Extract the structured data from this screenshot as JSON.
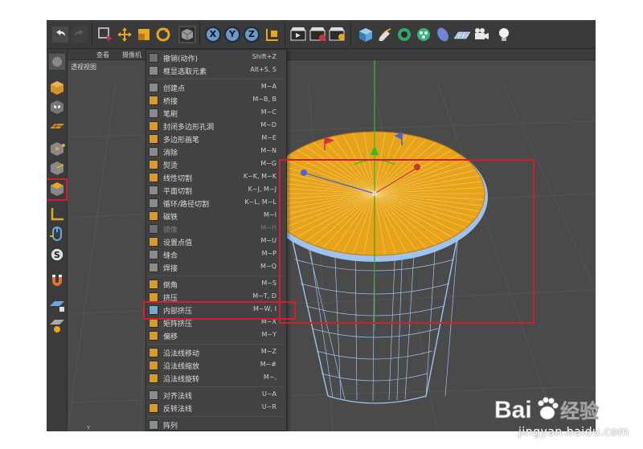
{
  "toolbar": {
    "icons": [
      "undo-icon",
      "redo-icon",
      "live-select-icon",
      "move-icon",
      "scale-icon",
      "rotate-icon",
      "object-mode-icon",
      "x-axis-lock",
      "y-axis-lock",
      "z-axis-lock",
      "world-coordinates-icon",
      "render-view-icon",
      "render-picture-viewer-icon",
      "render-settings-icon",
      "cube-icon",
      "pen-icon",
      "subdivision-icon",
      "cloner-icon",
      "deformer-icon",
      "floor-icon",
      "camera-icon",
      "light-icon"
    ],
    "x_label": "X",
    "y_label": "Y",
    "z_label": "Z"
  },
  "viewport": {
    "menu": [
      "查看",
      "摄像机",
      "显示"
    ],
    "label": "透视视图",
    "axis_y": "Y"
  },
  "context_menu": {
    "items": [
      {
        "label": "撤销(动作)",
        "shortcut": "Shift+Z",
        "icon": "undo-icon",
        "enabled": true
      },
      {
        "label": "框显选取元素",
        "shortcut": "Alt+S, S",
        "icon": "frame-selected-icon",
        "enabled": true
      },
      {
        "label": "创建点",
        "shortcut": "M~A",
        "icon": "create-point-icon",
        "enabled": true
      },
      {
        "label": "桥接",
        "shortcut": "M~B, B",
        "icon": "bridge-icon",
        "enabled": true
      },
      {
        "label": "笔刷",
        "shortcut": "M~C",
        "icon": "brush-icon",
        "enabled": true
      },
      {
        "label": "封闭多边形孔洞",
        "shortcut": "M~D",
        "icon": "close-polygon-hole-icon",
        "enabled": true
      },
      {
        "label": "多边形画笔",
        "shortcut": "M~E",
        "icon": "polygon-pen-icon",
        "enabled": true
      },
      {
        "label": "消除",
        "shortcut": "M~N",
        "icon": "dissolve-icon",
        "enabled": true
      },
      {
        "label": "熨烫",
        "shortcut": "M~G",
        "icon": "iron-icon",
        "enabled": true
      },
      {
        "label": "线性切割",
        "shortcut": "K~K, M~K",
        "icon": "line-cut-icon",
        "enabled": true
      },
      {
        "label": "平面切割",
        "shortcut": "K~J, M~J",
        "icon": "plane-cut-icon",
        "enabled": true
      },
      {
        "label": "循环/路径切割",
        "shortcut": "K~L, M~L",
        "icon": "loop-cut-icon",
        "enabled": true
      },
      {
        "label": "磁铁",
        "shortcut": "M~I",
        "icon": "magnet-icon",
        "enabled": true
      },
      {
        "label": "镜像",
        "shortcut": "M~H",
        "icon": "mirror-icon",
        "enabled": false
      },
      {
        "label": "设置点值",
        "shortcut": "M~U",
        "icon": "set-point-value-icon",
        "enabled": true
      },
      {
        "label": "缝合",
        "shortcut": "M~P",
        "icon": "stitch-icon",
        "enabled": true
      },
      {
        "label": "焊接",
        "shortcut": "M~Q",
        "icon": "weld-icon",
        "enabled": true
      },
      {
        "label": "倒角",
        "shortcut": "M~S",
        "icon": "bevel-icon",
        "enabled": true
      },
      {
        "label": "挤压",
        "shortcut": "M~T, D",
        "icon": "extrude-icon",
        "enabled": true
      },
      {
        "label": "内部挤压",
        "shortcut": "M~W, I",
        "icon": "extrude-inner-icon",
        "enabled": true
      },
      {
        "label": "矩阵挤压",
        "shortcut": "M~X",
        "icon": "matrix-extrude-icon",
        "enabled": true
      },
      {
        "label": "偏移",
        "shortcut": "M~Y",
        "icon": "offset-icon",
        "enabled": true
      },
      {
        "label": "沿法线移动",
        "shortcut": "M~Z",
        "icon": "normal-move-icon",
        "enabled": true
      },
      {
        "label": "沿法线缩放",
        "shortcut": "M~#",
        "icon": "normal-scale-icon",
        "enabled": true
      },
      {
        "label": "沿法线旋转",
        "shortcut": "M~,",
        "icon": "normal-rotate-icon",
        "enabled": true
      },
      {
        "label": "对齐法线",
        "shortcut": "U~A",
        "icon": "align-normals-icon",
        "enabled": true
      },
      {
        "label": "反转法线",
        "shortcut": "U~R",
        "icon": "reverse-normals-icon",
        "enabled": true
      },
      {
        "label": "阵列",
        "shortcut": "",
        "icon": "array-icon",
        "enabled": true
      }
    ],
    "highlighted": "内部挤压"
  },
  "left_tools": [
    "make-editable-icon",
    "model-mode-icon",
    "texture-mode-icon",
    "workplane-icon",
    "point-mode-icon",
    "edge-mode-icon",
    "polygon-mode-icon",
    "axis-mode-icon",
    "tweak-mode-icon",
    "solo-icon",
    "snap-icon",
    "lock-workplane-icon",
    "planar-workplane-icon"
  ],
  "colors": {
    "annotation": "#d21f2d",
    "cap_fill": "#e7a41b",
    "wire": "#8fb6e6",
    "axis_y": "#2ec02a",
    "axis_x": "#d0323a",
    "axis_z": "#4a62d6"
  },
  "watermark": {
    "brand": "Bai",
    "brand2": "经验",
    "url": "jingyan.baidu.com"
  }
}
